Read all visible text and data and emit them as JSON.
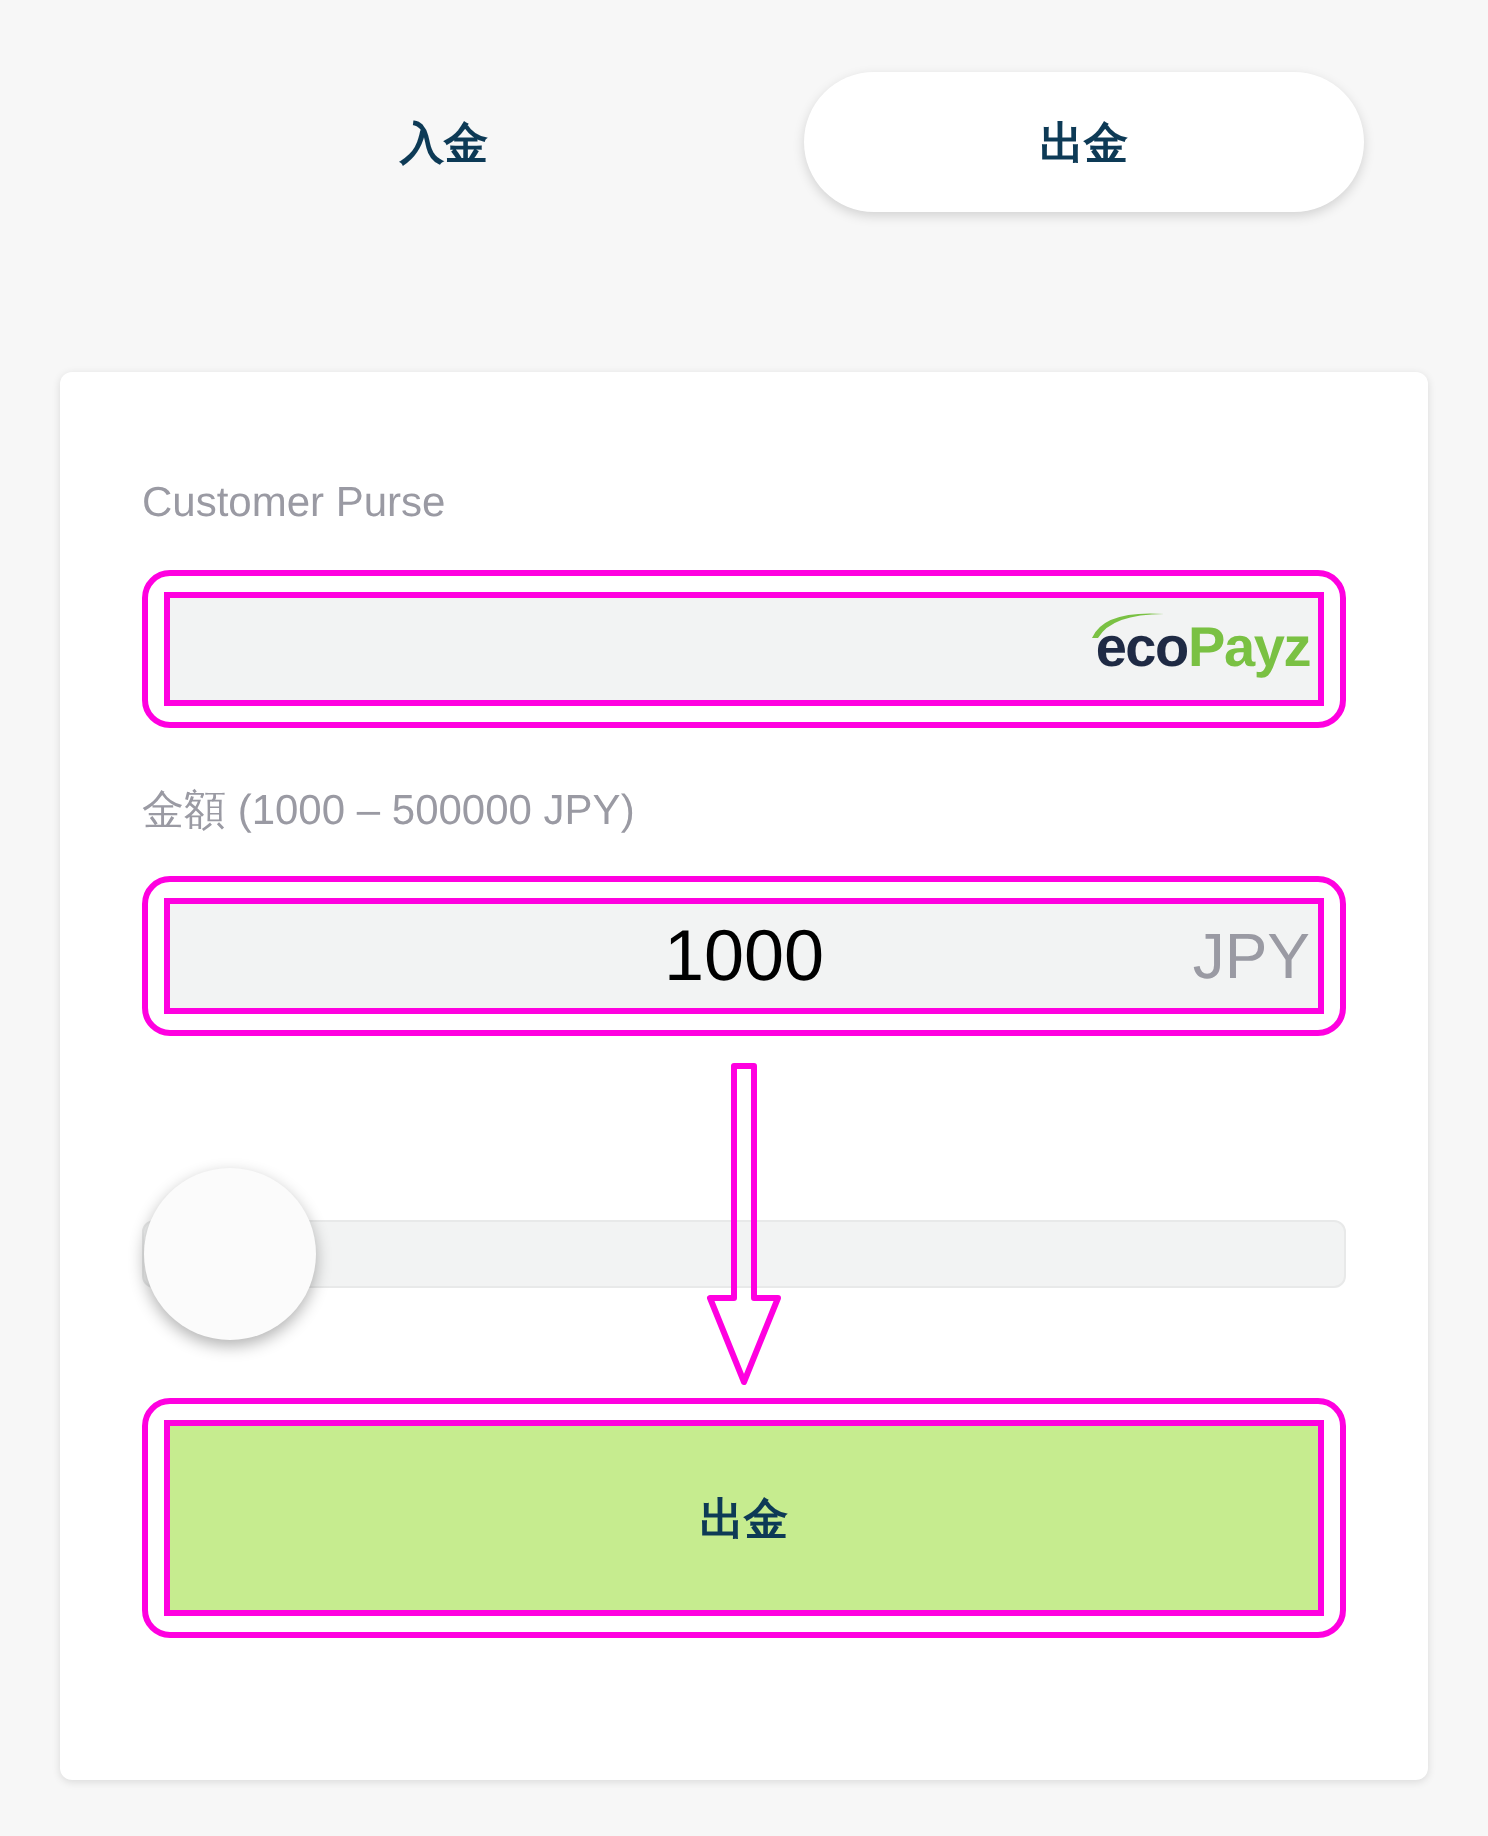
{
  "tabs": [
    {
      "label": "入金",
      "selected": false
    },
    {
      "label": "出金",
      "selected": true
    }
  ],
  "purse": {
    "label": "Customer Purse",
    "logo": {
      "part_1": "eco",
      "part_2": "Payz"
    },
    "highlighted": true
  },
  "amount": {
    "label": "金額 (1000 – 500000 JPY)",
    "value": "1000",
    "currency": "JPY",
    "highlighted": true
  },
  "slider": {
    "level": 0
  },
  "submit": {
    "label": "出金",
    "highlighted": true
  }
}
